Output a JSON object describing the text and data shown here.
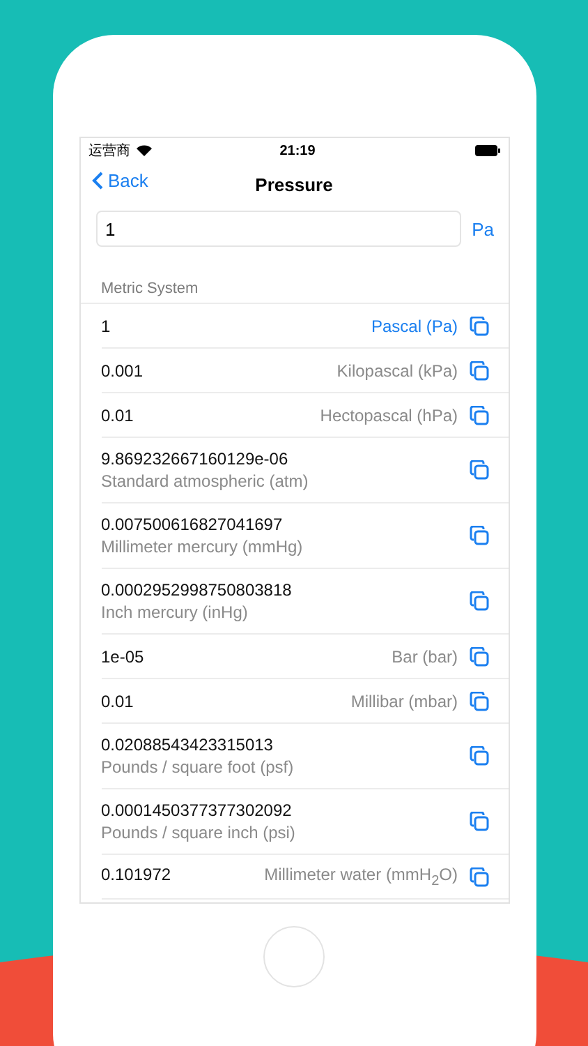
{
  "status_bar": {
    "carrier": "运营商",
    "time": "21:19"
  },
  "nav": {
    "back": "Back",
    "title": "Pressure"
  },
  "input": {
    "value": "1",
    "unit": "Pa"
  },
  "section": {
    "title": "Metric System",
    "rows": [
      {
        "kind": "inline",
        "value": "1",
        "unit": "Pascal (Pa)",
        "selected": true
      },
      {
        "kind": "inline",
        "value": "0.001",
        "unit": "Kilopascal (kPa)",
        "selected": false
      },
      {
        "kind": "inline",
        "value": "0.01",
        "unit": "Hectopascal (hPa)",
        "selected": false
      },
      {
        "kind": "stacked",
        "value": "9.869232667160129e-06",
        "unit": "Standard atmospheric (atm)",
        "selected": false
      },
      {
        "kind": "stacked",
        "value": "0.007500616827041697",
        "unit": "Millimeter mercury (mmHg)",
        "selected": false
      },
      {
        "kind": "stacked",
        "value": "0.0002952998750803818",
        "unit": "Inch mercury (inHg)",
        "selected": false
      },
      {
        "kind": "inline",
        "value": "1e-05",
        "unit": "Bar (bar)",
        "selected": false
      },
      {
        "kind": "inline",
        "value": "0.01",
        "unit": "Millibar (mbar)",
        "selected": false
      },
      {
        "kind": "stacked",
        "value": "0.02088543423315013",
        "unit": "Pounds / square foot (psf)",
        "selected": false
      },
      {
        "kind": "stacked",
        "value": "0.0001450377377302092",
        "unit": "Pounds / square inch (psi)",
        "selected": false
      },
      {
        "kind": "inline",
        "value": "0.101972",
        "unit": "Millimeter water (mmH$_{2}$O)",
        "selected": false
      }
    ]
  }
}
